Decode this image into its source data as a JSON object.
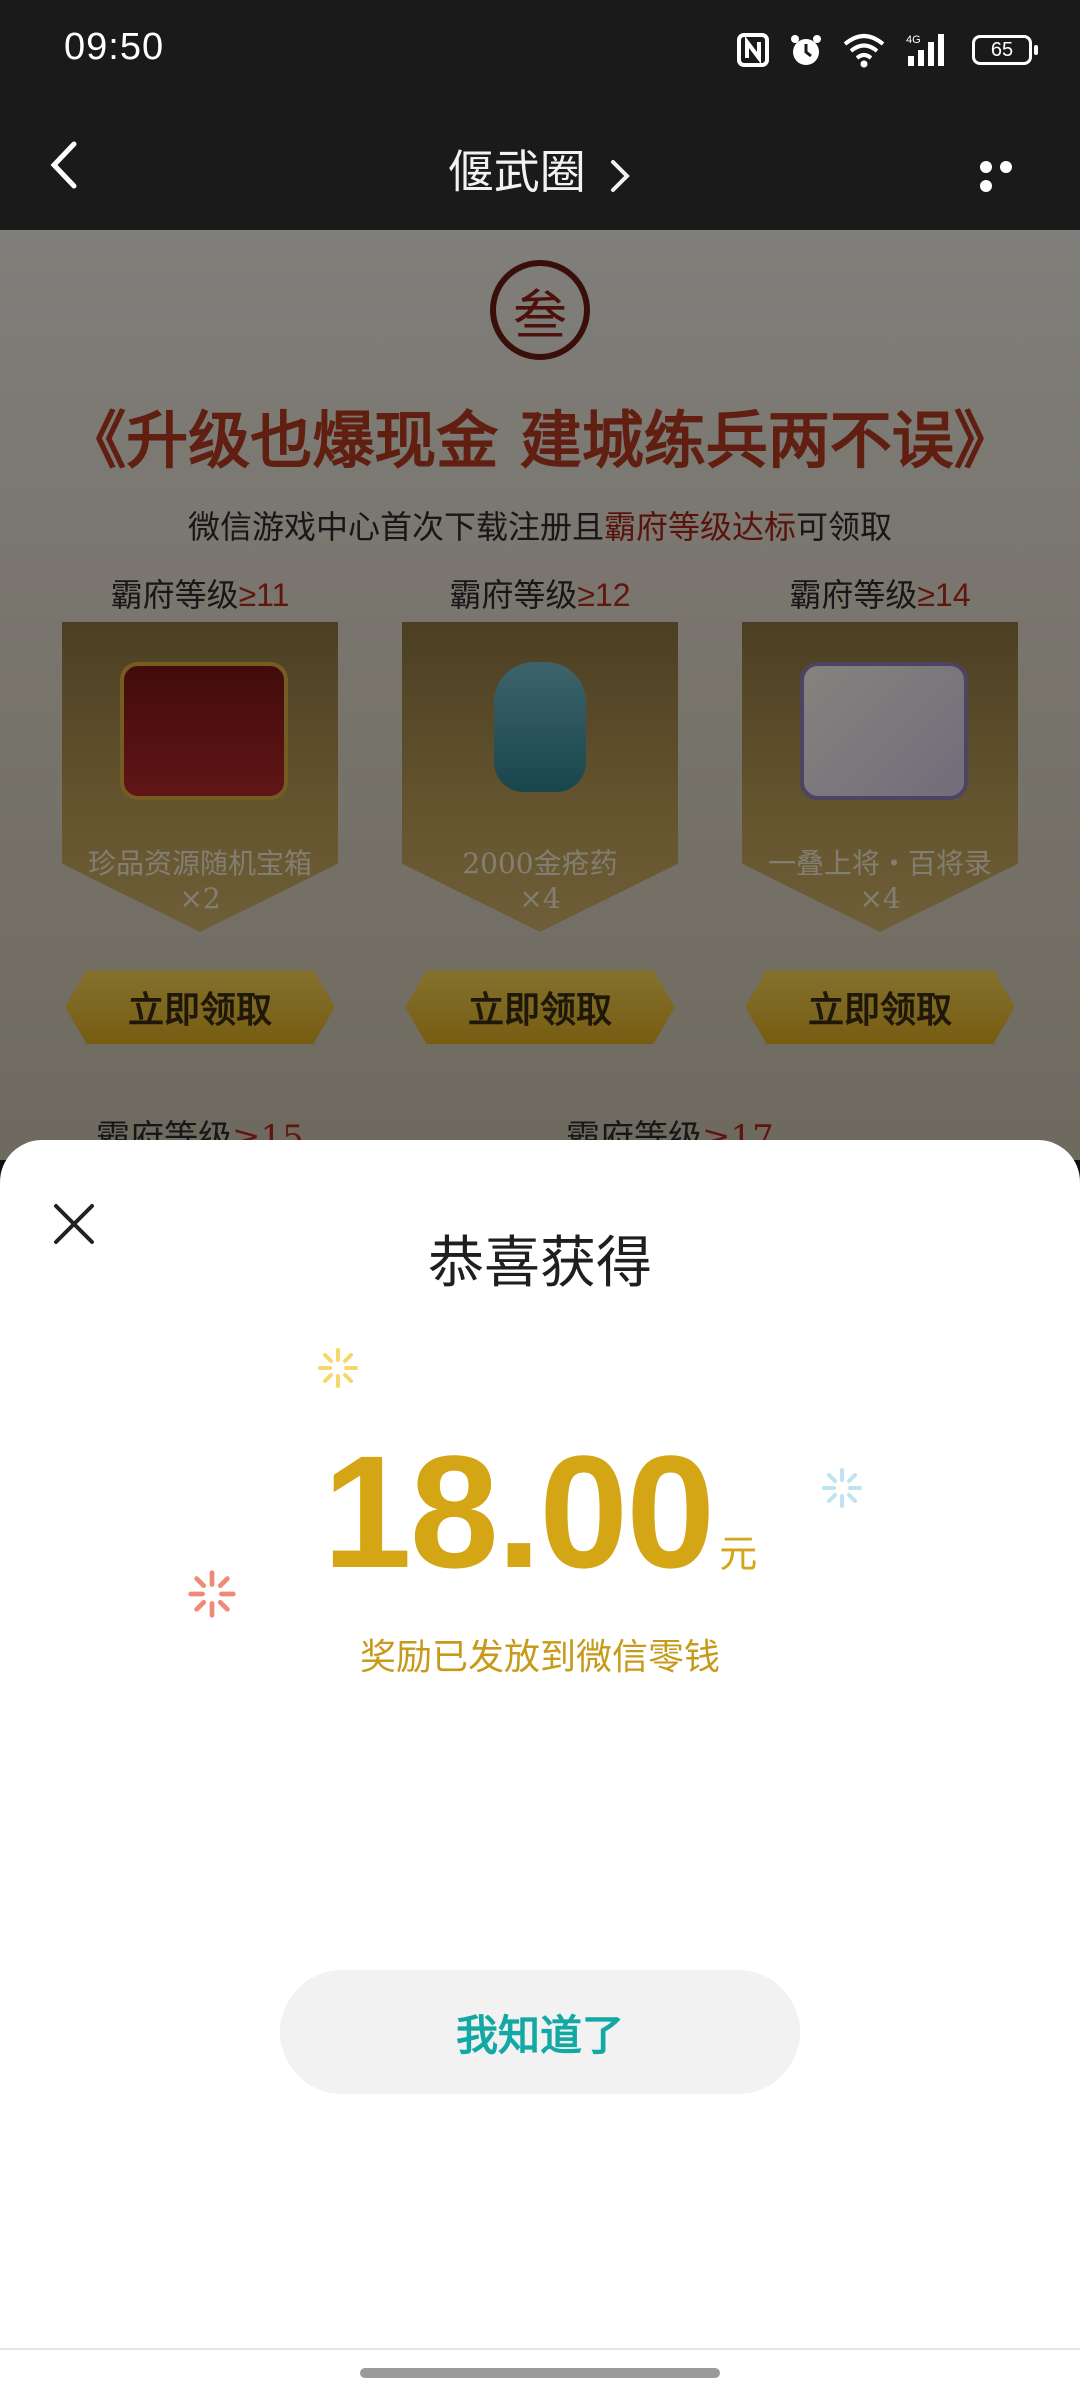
{
  "status_bar": {
    "time": "09:50",
    "battery": "65"
  },
  "nav": {
    "title": "偃武圈"
  },
  "background": {
    "headline": "《升级也爆现金 建城练兵两不误》",
    "subtitle_prefix": "微信游戏中心首次下载注册且",
    "subtitle_highlight": "霸府等级达标",
    "subtitle_suffix": "可领取",
    "tiers": [
      {
        "level_label": "霸府等级",
        "level_value": "≥11",
        "item": "珍品资源随机宝箱",
        "qty": "×2",
        "button": "立即领取"
      },
      {
        "level_label": "霸府等级",
        "level_value": "≥12",
        "item": "2000金疮药",
        "qty": "×4",
        "button": "立即领取"
      },
      {
        "level_label": "霸府等级",
        "level_value": "≥14",
        "item": "一叠上将・百将录",
        "qty": "×4",
        "button": "立即领取"
      }
    ],
    "next_left": {
      "label": "霸府等级",
      "value": "≥15"
    },
    "next_right": {
      "label": "霸府等级",
      "value": "≥17"
    }
  },
  "dialog": {
    "title": "恭喜获得",
    "amount": "18.00",
    "currency": "元",
    "notice": "奖励已发放到微信零钱",
    "confirm_label": "我知道了"
  },
  "colors": {
    "gold": "#d4a514",
    "teal": "#12a8a4",
    "spark_red": "#f08a76",
    "spark_blue": "#bfe3f2",
    "spark_yellow": "#f5d86a"
  }
}
